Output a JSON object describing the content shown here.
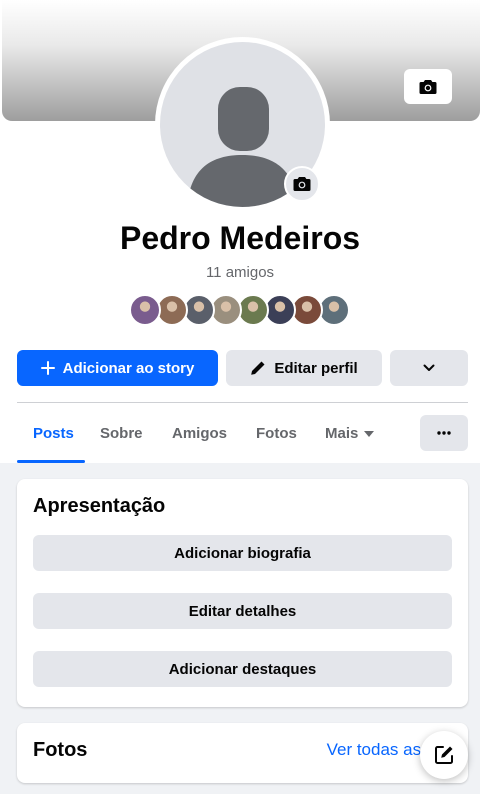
{
  "profile": {
    "name": "Pedro Medeiros",
    "friends_count": "11 amigos",
    "friend_avatars": [
      {
        "color": "#7a5c8e"
      },
      {
        "color": "#8d6b55"
      },
      {
        "color": "#5a5f6a"
      },
      {
        "color": "#9a8f7e"
      },
      {
        "color": "#6b7a4f"
      },
      {
        "color": "#3b3f57"
      },
      {
        "color": "#7a4a3a"
      },
      {
        "color": "#5e6f7a"
      }
    ]
  },
  "actions": {
    "add_story": "Adicionar ao story",
    "edit_profile": "Editar perfil"
  },
  "tabs": [
    {
      "label": "Posts",
      "active": true
    },
    {
      "label": "Sobre"
    },
    {
      "label": "Amigos"
    },
    {
      "label": "Fotos"
    },
    {
      "label": "Mais"
    }
  ],
  "intro": {
    "title": "Apresentação",
    "buttons": [
      "Adicionar biografia",
      "Editar detalhes",
      "Adicionar destaques"
    ]
  },
  "photos": {
    "title": "Fotos",
    "see_all": "Ver todas as fo"
  },
  "colors": {
    "accent": "#0866ff",
    "button_gray": "#e4e6eb",
    "background": "#f0f2f5"
  }
}
